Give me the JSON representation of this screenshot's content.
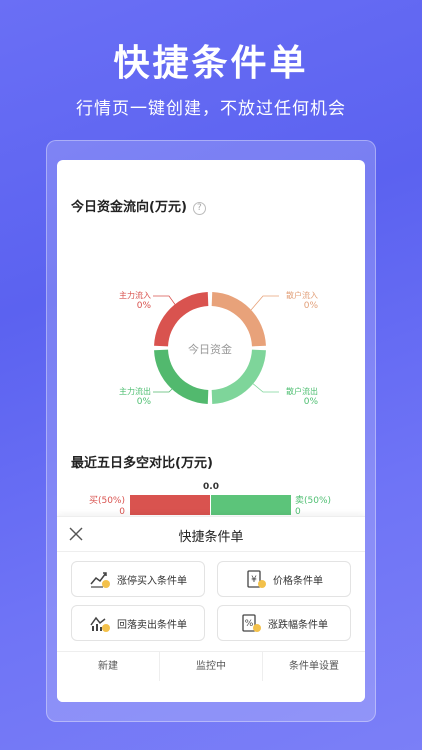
{
  "hero": {
    "title": "快捷条件单",
    "subtitle": "行情页一键创建，不放过任何机会"
  },
  "fund_flow": {
    "title": "今日资金流向(万元)",
    "help_icon": "?",
    "center_label": "今日资金",
    "segments": [
      {
        "label": "主力流入",
        "value": "0%",
        "color": "#d9534f"
      },
      {
        "label": "散户流入",
        "value": "0%",
        "color": "#e8a27a"
      },
      {
        "label": "散户流出",
        "value": "0%",
        "color": "#7ed59a"
      },
      {
        "label": "主力流出",
        "value": "0%",
        "color": "#52b96e"
      }
    ]
  },
  "long_short": {
    "title": "最近五日多空对比(万元)",
    "net": "0.0",
    "buy_label": "买(50%)",
    "buy_value": "0",
    "sell_label": "卖(50%)",
    "sell_value": "0",
    "buy_color": "#d9534f",
    "sell_color": "#5cc47a"
  },
  "sheet": {
    "title": "快捷条件单",
    "options": [
      {
        "label": "涨停买入条件单",
        "icon": "limit-up-chart-icon"
      },
      {
        "label": "价格条件单",
        "icon": "yen-price-icon"
      },
      {
        "label": "回落卖出条件单",
        "icon": "pullback-chart-icon"
      },
      {
        "label": "涨跌幅条件单",
        "icon": "percent-icon"
      }
    ],
    "tabs": [
      "新建",
      "监控中",
      "条件单设置"
    ]
  }
}
